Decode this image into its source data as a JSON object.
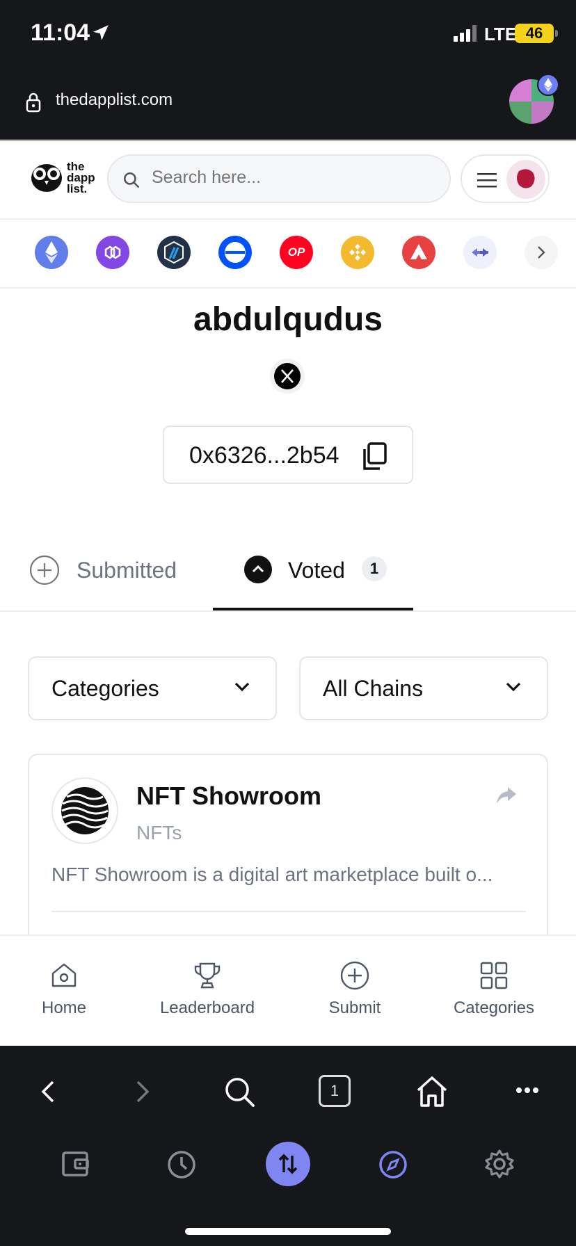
{
  "status_bar": {
    "time": "11:04",
    "network": "LTE",
    "battery": "46"
  },
  "browser": {
    "url": "thedapplist.com"
  },
  "header": {
    "logo_text": "the dapp list.",
    "search_placeholder": "Search here..."
  },
  "chains": [
    "ethereum",
    "polygon",
    "arbitrum",
    "base",
    "optimism",
    "bnb",
    "avalanche",
    "bridge",
    "more"
  ],
  "chain_colors": {
    "ethereum": "#627eea",
    "polygon": "#8247e5",
    "arbitrum": "#213147",
    "base": "#0052ff",
    "optimism": "#ff0420",
    "bnb": "#f3ba2f",
    "avalanche": "#e84142",
    "bridge": "#eef0fb",
    "more": "#f5f5f5"
  },
  "chain_optimism_label": "OP",
  "profile": {
    "username": "abdulqudus",
    "address": "0x6326...2b54"
  },
  "tabs": {
    "submitted": "Submitted",
    "voted": "Voted",
    "voted_count": "1"
  },
  "filters": {
    "categories": "Categories",
    "chains": "All Chains"
  },
  "card": {
    "title": "NFT Showroom",
    "category": "NFTs",
    "description": "NFT Showroom is a digital art marketplace built o..."
  },
  "bottom_nav": {
    "home": "Home",
    "leaderboard": "Leaderboard",
    "submit": "Submit",
    "categories": "Categories"
  },
  "browser_tabs_count": "1"
}
